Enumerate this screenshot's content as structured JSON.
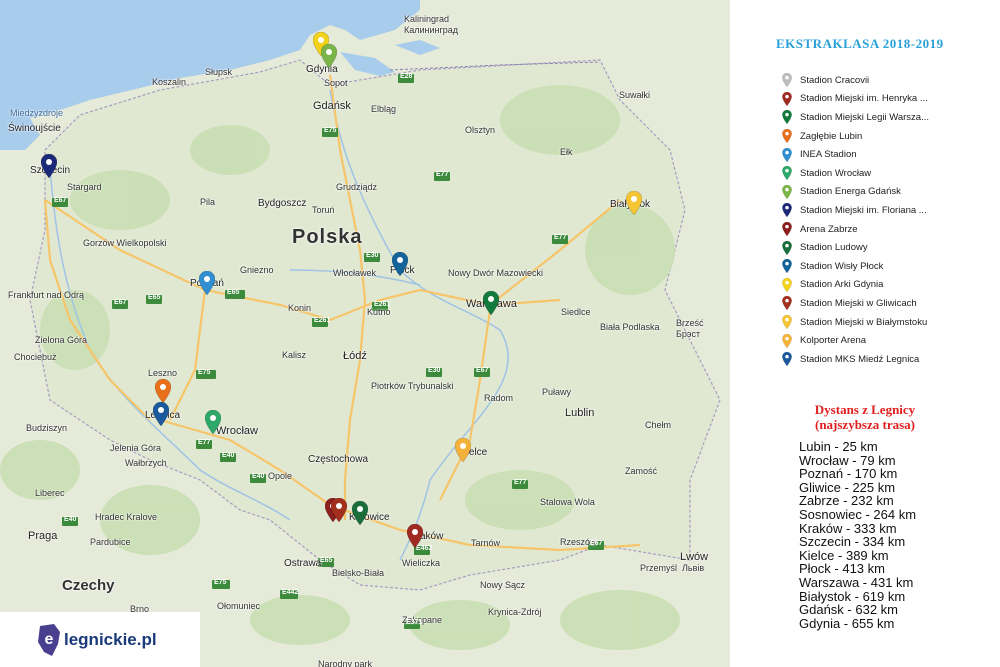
{
  "map": {
    "countries": [
      "Polska",
      "Czechy"
    ],
    "water": [
      "Miedzyzdroje"
    ],
    "labels": [
      {
        "text": "Świnoujście",
        "cls": "city"
      },
      {
        "text": "Szczecin",
        "cls": "city"
      },
      {
        "text": "Stargard",
        "cls": ""
      },
      {
        "text": "Pila",
        "cls": ""
      },
      {
        "text": "Gorzów Wielkopolski",
        "cls": ""
      },
      {
        "text": "Frankfurt nad Odrą",
        "cls": ""
      },
      {
        "text": "Zielona Góra",
        "cls": ""
      },
      {
        "text": "Chociebuż",
        "cls": ""
      },
      {
        "text": "Leszno",
        "cls": ""
      },
      {
        "text": "Legnica",
        "cls": "city"
      },
      {
        "text": "Budziszyn",
        "cls": ""
      },
      {
        "text": "Jelenia Góra",
        "cls": ""
      },
      {
        "text": "Wałbrzych",
        "cls": ""
      },
      {
        "text": "Liberec",
        "cls": ""
      },
      {
        "text": "Hradec Kralove",
        "cls": ""
      },
      {
        "text": "Pardubice",
        "cls": ""
      },
      {
        "text": "Praga",
        "cls": "big"
      },
      {
        "text": "Słupsk",
        "cls": ""
      },
      {
        "text": "Koszalin",
        "cls": ""
      },
      {
        "text": "Gdynia",
        "cls": "city"
      },
      {
        "text": "Sopot",
        "cls": ""
      },
      {
        "text": "Gdańsk",
        "cls": "big"
      },
      {
        "text": "Elbląg",
        "cls": ""
      },
      {
        "text": "Kaliningrad",
        "cls": ""
      },
      {
        "text": "Калининград",
        "cls": ""
      },
      {
        "text": "Olsztyn",
        "cls": ""
      },
      {
        "text": "Ełk",
        "cls": ""
      },
      {
        "text": "Suwałki",
        "cls": ""
      },
      {
        "text": "Bydgoszcz",
        "cls": "city"
      },
      {
        "text": "Toruń",
        "cls": ""
      },
      {
        "text": "Grudziądz",
        "cls": ""
      },
      {
        "text": "Włocławek",
        "cls": ""
      },
      {
        "text": "Płock",
        "cls": "city"
      },
      {
        "text": "Gniezno",
        "cls": ""
      },
      {
        "text": "Poznań",
        "cls": "city"
      },
      {
        "text": "Konin",
        "cls": ""
      },
      {
        "text": "Kutno",
        "cls": ""
      },
      {
        "text": "Nowy Dwór Mazowiecki",
        "cls": ""
      },
      {
        "text": "Warszawa",
        "cls": "big"
      },
      {
        "text": "Siedlce",
        "cls": ""
      },
      {
        "text": "Biała Podlaska",
        "cls": ""
      },
      {
        "text": "Brześć",
        "cls": ""
      },
      {
        "text": "Брэст",
        "cls": ""
      },
      {
        "text": "Białystok",
        "cls": "city"
      },
      {
        "text": "Kalisz",
        "cls": ""
      },
      {
        "text": "Łódź",
        "cls": "big"
      },
      {
        "text": "Piotrków Trybunalski",
        "cls": ""
      },
      {
        "text": "Radom",
        "cls": ""
      },
      {
        "text": "Puławy",
        "cls": ""
      },
      {
        "text": "Lublin",
        "cls": "big"
      },
      {
        "text": "Chełm",
        "cls": ""
      },
      {
        "text": "Wrocław",
        "cls": "big"
      },
      {
        "text": "Opole",
        "cls": ""
      },
      {
        "text": "Częstochowa",
        "cls": "city"
      },
      {
        "text": "Kielce",
        "cls": "city"
      },
      {
        "text": "Zamość",
        "cls": ""
      },
      {
        "text": "Stalowa Wola",
        "cls": ""
      },
      {
        "text": "Katowice",
        "cls": "city"
      },
      {
        "text": "Kraków",
        "cls": "city"
      },
      {
        "text": "Tarnów",
        "cls": ""
      },
      {
        "text": "Rzeszów",
        "cls": ""
      },
      {
        "text": "Przemyśl",
        "cls": ""
      },
      {
        "text": "Lwów",
        "cls": "big"
      },
      {
        "text": "Львів",
        "cls": ""
      },
      {
        "text": "Ostrawa",
        "cls": "city"
      },
      {
        "text": "Bielsko-Biała",
        "cls": ""
      },
      {
        "text": "Wieliczka",
        "cls": ""
      },
      {
        "text": "Nowy Sącz",
        "cls": ""
      },
      {
        "text": "Krynica-Zdrój",
        "cls": ""
      },
      {
        "text": "Zakopane",
        "cls": ""
      },
      {
        "text": "Ołomuniec",
        "cls": ""
      },
      {
        "text": "Brno",
        "cls": ""
      },
      {
        "text": "Narodny park",
        "cls": ""
      }
    ],
    "roads": [
      "E28",
      "E28",
      "E75",
      "E77",
      "E77",
      "E67",
      "E67",
      "E65",
      "E65",
      "E30",
      "E261",
      "E75",
      "E261",
      "E30",
      "E67",
      "E77",
      "E40",
      "E40",
      "E40",
      "E65",
      "E75",
      "E442",
      "E462",
      "E77",
      "E67",
      "E371",
      "E371"
    ],
    "pin_colors": {
      "cracovia": "#bdbdbd",
      "wisla": "#a02b22",
      "legia": "#137a3e",
      "zaglebie": "#e8701a",
      "inea": "#2f8fd0",
      "wroclaw": "#2ea86a",
      "lechia": "#7bb54a",
      "pogon": "#1b2a78",
      "gornik": "#8c1e1e",
      "ludowy": "#1b6e3c",
      "plock": "#14639a",
      "arka": "#f2d21a",
      "gliwice": "#a3301e",
      "jagiellonia": "#f5c534",
      "korona": "#f5b23a",
      "miedz": "#1a5a9c"
    }
  },
  "logo": {
    "text": "legnickie.pl",
    "letter": "e"
  },
  "legend": {
    "title": "EKSTRAKLASA 2018-2019",
    "items": [
      {
        "name": "Stadion Cracovii",
        "color": "#bdbdbd"
      },
      {
        "name": "Stadion Miejski im. Henryka ...",
        "color": "#a02b22"
      },
      {
        "name": "Stadion Miejski Legii Warsza...",
        "color": "#137a3e"
      },
      {
        "name": "Zagłębie Lubin",
        "color": "#e8701a"
      },
      {
        "name": "INEA Stadion",
        "color": "#2f8fd0"
      },
      {
        "name": "Stadion Wrocław",
        "color": "#2ea86a"
      },
      {
        "name": "Stadion Energa Gdańsk",
        "color": "#7bb54a"
      },
      {
        "name": "Stadion Miejski im. Floriana ...",
        "color": "#1b2a78"
      },
      {
        "name": "Arena Zabrze",
        "color": "#8c1e1e"
      },
      {
        "name": "Stadion Ludowy",
        "color": "#1b6e3c"
      },
      {
        "name": "Stadion Wisły Płock",
        "color": "#14639a"
      },
      {
        "name": "Stadion Arki Gdynia",
        "color": "#f2d21a"
      },
      {
        "name": "Stadion Miejski w Gliwicach",
        "color": "#a3301e"
      },
      {
        "name": "Stadion Miejski w Białymstoku",
        "color": "#f5c534"
      },
      {
        "name": "Kolporter Arena",
        "color": "#f5b23a"
      },
      {
        "name": "Stadion MKS Miedź Legnica",
        "color": "#1a5a9c"
      }
    ]
  },
  "distances": {
    "title_line1": "Dystans z Legnicy",
    "title_line2": "(najszybsza trasa)",
    "items": [
      "Lubin - 25 km",
      "Wrocław - 79 km",
      "Poznań - 170 km",
      "Gliwice - 225 km",
      "Zabrze - 232 km",
      "Sosnowiec - 264 km",
      "Kraków - 333 km",
      "Szczecin - 334 km",
      "Kielce - 389 km",
      "Płock - 413 km",
      "Warszawa - 431 km",
      "Białystok - 619 km",
      "Gdańsk - 632 km",
      "Gdynia - 655 km"
    ]
  }
}
